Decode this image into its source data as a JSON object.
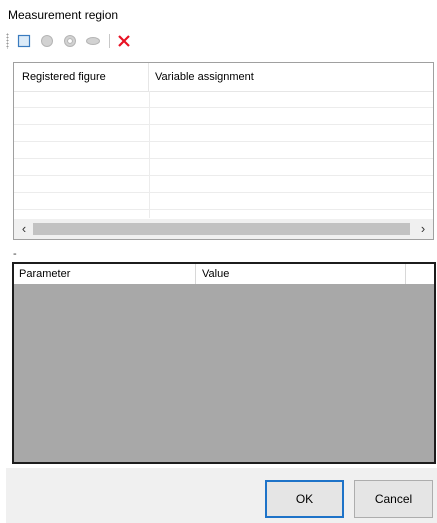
{
  "section": {
    "title": "Measurement region"
  },
  "toolbar": {
    "buttons": [
      {
        "name": "rectangle-icon"
      },
      {
        "name": "circle-icon"
      },
      {
        "name": "ring-icon"
      },
      {
        "name": "ellipse-icon"
      },
      {
        "name": "delete-icon"
      }
    ]
  },
  "figures_grid": {
    "columns": [
      "Registered figure",
      "Variable assignment"
    ],
    "rows": []
  },
  "splitter": {
    "label": "-"
  },
  "params_grid": {
    "columns": [
      "Parameter",
      "Value"
    ],
    "rows": []
  },
  "footer": {
    "ok_label": "OK",
    "cancel_label": "Cancel"
  },
  "colors": {
    "delete": "#e81123",
    "ok_border": "#1e73c8",
    "grid_background": "#a8a8a8"
  }
}
